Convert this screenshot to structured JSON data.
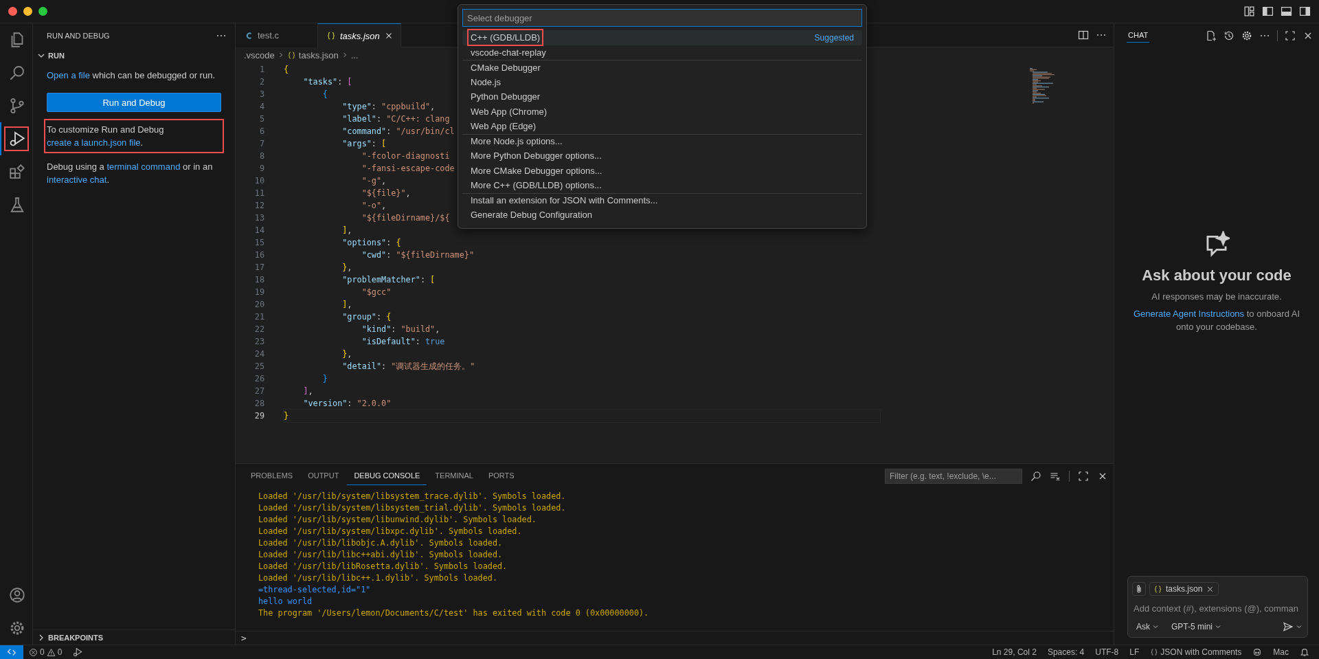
{
  "activity_bar": {
    "items": [
      {
        "kind": "files",
        "selected": false,
        "highlighted": false
      },
      {
        "kind": "search",
        "selected": false,
        "highlighted": false
      },
      {
        "kind": "branch",
        "selected": false,
        "highlighted": false
      },
      {
        "kind": "debug",
        "selected": true,
        "highlighted": true
      },
      {
        "kind": "extensions",
        "selected": false,
        "highlighted": false
      },
      {
        "kind": "flask",
        "selected": false,
        "highlighted": false
      }
    ],
    "bottom_items": [
      {
        "kind": "account"
      },
      {
        "kind": "gear"
      }
    ]
  },
  "sidebar": {
    "title": "RUN AND DEBUG",
    "section": {
      "title": "RUN",
      "expanded": true
    },
    "blocks": [
      {
        "kind": "paragraph",
        "highlighted": false,
        "parts": [
          {
            "text": "Open a file",
            "link": true
          },
          {
            "text": " which can be debugged or run.",
            "link": false
          }
        ]
      },
      {
        "kind": "button",
        "label": "Run and Debug"
      },
      {
        "kind": "paragraph",
        "highlighted": true,
        "parts": [
          {
            "text": "To customize Run and Debug ",
            "link": false
          },
          {
            "text": "create a launch.json file",
            "link": true
          },
          {
            "text": ".",
            "link": false
          }
        ]
      },
      {
        "kind": "paragraph",
        "highlighted": false,
        "parts": [
          {
            "text": "Debug using a ",
            "link": false
          },
          {
            "text": "terminal command",
            "link": true
          },
          {
            "text": " or in an ",
            "link": false
          },
          {
            "text": "interactive chat",
            "link": true
          },
          {
            "text": ".",
            "link": false
          }
        ]
      }
    ],
    "bottom_section": {
      "title": "BREAKPOINTS",
      "expanded": false
    }
  },
  "editor": {
    "tabs": [
      {
        "label": "test.c",
        "kind": "c",
        "selected": false,
        "preview": false
      },
      {
        "label": "tasks.json",
        "kind": "json",
        "selected": true,
        "preview": true
      }
    ],
    "breadcrumb": [
      {
        "label": ".vscode",
        "kind": "folder"
      },
      {
        "label": "tasks.json",
        "kind": "json"
      },
      {
        "label": "...",
        "kind": "more"
      }
    ],
    "lines": [
      {
        "number": "1",
        "current": false,
        "tokens": [
          {
            "text": "{",
            "kind": "b1"
          }
        ]
      },
      {
        "number": "2",
        "current": false,
        "tokens": [
          {
            "text": "    \"tasks\"",
            "kind": "key"
          },
          {
            "text": ": ",
            "kind": "p"
          },
          {
            "text": "[",
            "kind": "b2"
          }
        ]
      },
      {
        "number": "3",
        "current": false,
        "tokens": [
          {
            "text": "        {",
            "kind": "b3"
          }
        ]
      },
      {
        "number": "4",
        "current": false,
        "tokens": [
          {
            "text": "            \"type\"",
            "kind": "key"
          },
          {
            "text": ": ",
            "kind": "p"
          },
          {
            "text": "\"cppbuild\"",
            "kind": "str"
          },
          {
            "text": ",",
            "kind": "p"
          }
        ]
      },
      {
        "number": "5",
        "current": false,
        "tokens": [
          {
            "text": "            \"label\"",
            "kind": "key"
          },
          {
            "text": ": ",
            "kind": "p"
          },
          {
            "text": "\"C/C++: clang",
            "kind": "str"
          }
        ]
      },
      {
        "number": "6",
        "current": false,
        "tokens": [
          {
            "text": "            \"command\"",
            "kind": "key"
          },
          {
            "text": ": ",
            "kind": "p"
          },
          {
            "text": "\"/usr/bin/cl",
            "kind": "str"
          }
        ]
      },
      {
        "number": "7",
        "current": false,
        "tokens": [
          {
            "text": "            \"args\"",
            "kind": "key"
          },
          {
            "text": ": ",
            "kind": "p"
          },
          {
            "text": "[",
            "kind": "b1"
          }
        ]
      },
      {
        "number": "8",
        "current": false,
        "tokens": [
          {
            "text": "                \"-fcolor-diagnosti",
            "kind": "str"
          }
        ]
      },
      {
        "number": "9",
        "current": false,
        "tokens": [
          {
            "text": "                \"-fansi-escape-code",
            "kind": "str"
          }
        ]
      },
      {
        "number": "10",
        "current": false,
        "tokens": [
          {
            "text": "                \"-g\"",
            "kind": "str"
          },
          {
            "text": ",",
            "kind": "p"
          }
        ]
      },
      {
        "number": "11",
        "current": false,
        "tokens": [
          {
            "text": "                \"${file}\"",
            "kind": "str"
          },
          {
            "text": ",",
            "kind": "p"
          }
        ]
      },
      {
        "number": "12",
        "current": false,
        "tokens": [
          {
            "text": "                \"-o\"",
            "kind": "str"
          },
          {
            "text": ",",
            "kind": "p"
          }
        ]
      },
      {
        "number": "13",
        "current": false,
        "tokens": [
          {
            "text": "                \"${fileDirname}/${",
            "kind": "str"
          }
        ]
      },
      {
        "number": "14",
        "current": false,
        "tokens": [
          {
            "text": "            ]",
            "kind": "b1"
          },
          {
            "text": ",",
            "kind": "p"
          }
        ]
      },
      {
        "number": "15",
        "current": false,
        "tokens": [
          {
            "text": "            \"options\"",
            "kind": "key"
          },
          {
            "text": ": ",
            "kind": "p"
          },
          {
            "text": "{",
            "kind": "b1"
          }
        ]
      },
      {
        "number": "16",
        "current": false,
        "tokens": [
          {
            "text": "                \"cwd\"",
            "kind": "key"
          },
          {
            "text": ": ",
            "kind": "p"
          },
          {
            "text": "\"${fileDirname}\"",
            "kind": "str"
          }
        ]
      },
      {
        "number": "17",
        "current": false,
        "tokens": [
          {
            "text": "            }",
            "kind": "b1"
          },
          {
            "text": ",",
            "kind": "p"
          }
        ]
      },
      {
        "number": "18",
        "current": false,
        "tokens": [
          {
            "text": "            \"problemMatcher\"",
            "kind": "key"
          },
          {
            "text": ": ",
            "kind": "p"
          },
          {
            "text": "[",
            "kind": "b1"
          }
        ]
      },
      {
        "number": "19",
        "current": false,
        "tokens": [
          {
            "text": "                \"$gcc\"",
            "kind": "str"
          }
        ]
      },
      {
        "number": "20",
        "current": false,
        "tokens": [
          {
            "text": "            ]",
            "kind": "b1"
          },
          {
            "text": ",",
            "kind": "p"
          }
        ]
      },
      {
        "number": "21",
        "current": false,
        "tokens": [
          {
            "text": "            \"group\"",
            "kind": "key"
          },
          {
            "text": ": ",
            "kind": "p"
          },
          {
            "text": "{",
            "kind": "b1"
          }
        ]
      },
      {
        "number": "22",
        "current": false,
        "tokens": [
          {
            "text": "                \"kind\"",
            "kind": "key"
          },
          {
            "text": ": ",
            "kind": "p"
          },
          {
            "text": "\"build\"",
            "kind": "str"
          },
          {
            "text": ",",
            "kind": "p"
          }
        ]
      },
      {
        "number": "23",
        "current": false,
        "tokens": [
          {
            "text": "                \"isDefault\"",
            "kind": "key"
          },
          {
            "text": ": ",
            "kind": "p"
          },
          {
            "text": "true",
            "kind": "bool"
          }
        ]
      },
      {
        "number": "24",
        "current": false,
        "tokens": [
          {
            "text": "            }",
            "kind": "b1"
          },
          {
            "text": ",",
            "kind": "p"
          }
        ]
      },
      {
        "number": "25",
        "current": false,
        "tokens": [
          {
            "text": "            \"detail\"",
            "kind": "key"
          },
          {
            "text": ": ",
            "kind": "p"
          },
          {
            "text": "\"调试器生成的任务。\"",
            "kind": "str"
          }
        ]
      },
      {
        "number": "26",
        "current": false,
        "tokens": [
          {
            "text": "        }",
            "kind": "b3"
          }
        ]
      },
      {
        "number": "27",
        "current": false,
        "tokens": [
          {
            "text": "    ]",
            "kind": "b2"
          },
          {
            "text": ",",
            "kind": "p"
          }
        ]
      },
      {
        "number": "28",
        "current": false,
        "tokens": [
          {
            "text": "    \"version\"",
            "kind": "key"
          },
          {
            "text": ": ",
            "kind": "p"
          },
          {
            "text": "\"2.0.0\"",
            "kind": "str"
          }
        ]
      },
      {
        "number": "29",
        "current": true,
        "tokens": [
          {
            "text": "}",
            "kind": "b1"
          }
        ]
      }
    ]
  },
  "quick_pick": {
    "placeholder": "Select debugger",
    "items": [
      {
        "label": "C++ (GDB/LLDB)",
        "selected": true,
        "highlighted": true,
        "separator": false,
        "badge": "Suggested"
      },
      {
        "label": "vscode-chat-replay",
        "selected": false,
        "highlighted": false,
        "separator": false
      },
      {
        "label": "CMake Debugger",
        "selected": false,
        "highlighted": false,
        "separator": true
      },
      {
        "label": "Node.js",
        "selected": false,
        "highlighted": false,
        "separator": false
      },
      {
        "label": "Python Debugger",
        "selected": false,
        "highlighted": false,
        "separator": false
      },
      {
        "label": "Web App (Chrome)",
        "selected": false,
        "highlighted": false,
        "separator": false
      },
      {
        "label": "Web App (Edge)",
        "selected": false,
        "highlighted": false,
        "separator": false
      },
      {
        "label": "More Node.js options...",
        "selected": false,
        "highlighted": false,
        "separator": true
      },
      {
        "label": "More Python Debugger options...",
        "selected": false,
        "highlighted": false,
        "separator": false
      },
      {
        "label": "More CMake Debugger options...",
        "selected": false,
        "highlighted": false,
        "separator": false
      },
      {
        "label": "More C++ (GDB/LLDB) options...",
        "selected": false,
        "highlighted": false,
        "separator": false
      },
      {
        "label": "Install an extension for JSON with Comments...",
        "selected": false,
        "highlighted": false,
        "separator": true
      },
      {
        "label": "Generate Debug Configuration",
        "selected": false,
        "highlighted": false,
        "separator": false
      }
    ]
  },
  "panel": {
    "tabs": [
      {
        "label": "PROBLEMS",
        "selected": false
      },
      {
        "label": "OUTPUT",
        "selected": false
      },
      {
        "label": "DEBUG CONSOLE",
        "selected": true
      },
      {
        "label": "TERMINAL",
        "selected": false
      },
      {
        "label": "PORTS",
        "selected": false
      }
    ],
    "filter_placeholder": "Filter (e.g. text, !exclude, \\e...",
    "lines": [
      {
        "text": "Loaded '/usr/lib/system/libsystem_trace.dylib'. Symbols loaded.",
        "kind": "output"
      },
      {
        "text": "Loaded '/usr/lib/system/libsystem_trial.dylib'. Symbols loaded.",
        "kind": "output"
      },
      {
        "text": "Loaded '/usr/lib/system/libunwind.dylib'. Symbols loaded.",
        "kind": "output"
      },
      {
        "text": "Loaded '/usr/lib/system/libxpc.dylib'. Symbols loaded.",
        "kind": "output"
      },
      {
        "text": "Loaded '/usr/lib/libobjc.A.dylib'. Symbols loaded.",
        "kind": "output"
      },
      {
        "text": "Loaded '/usr/lib/libc++abi.dylib'. Symbols loaded.",
        "kind": "output"
      },
      {
        "text": "Loaded '/usr/lib/libRosetta.dylib'. Symbols loaded.",
        "kind": "output"
      },
      {
        "text": "Loaded '/usr/lib/libc++.1.dylib'. Symbols loaded.",
        "kind": "output"
      },
      {
        "text": "=thread-selected,id=\"1\"",
        "kind": "info"
      },
      {
        "text": "hello world",
        "kind": "info"
      },
      {
        "text": "The program '/Users/lemon/Documents/C/test' has exited with code 0 (0x00000000).",
        "kind": "output"
      }
    ],
    "prompt": ">"
  },
  "chat": {
    "tab": {
      "label": "CHAT",
      "selected": true
    },
    "title": "Ask about your code",
    "subtitle": "AI responses may be inaccurate.",
    "note": [
      {
        "text": "Generate Agent Instructions",
        "link": true
      },
      {
        "text": " to onboard AI onto your codebase.",
        "link": false
      }
    ],
    "input": {
      "chip": "tasks.json",
      "placeholder": "Add context (#), extensions (@), comman",
      "mode": "Ask",
      "model": "GPT-5 mini"
    }
  },
  "status_bar": {
    "errors": "0",
    "warnings": "0",
    "items": [
      {
        "kind": "text",
        "text": "Ln 29, Col 2"
      },
      {
        "kind": "text",
        "text": "Spaces: 4"
      },
      {
        "kind": "text",
        "text": "UTF-8"
      },
      {
        "kind": "text",
        "text": "LF"
      },
      {
        "kind": "language",
        "text": "JSON with Comments"
      },
      {
        "kind": "robot"
      },
      {
        "kind": "text",
        "text": "Mac"
      },
      {
        "kind": "bell"
      }
    ]
  }
}
